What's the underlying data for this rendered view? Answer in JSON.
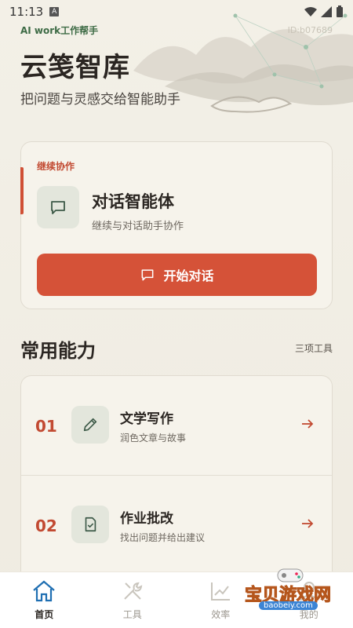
{
  "status_bar": {
    "time": "11:13",
    "notif_glyph": "A"
  },
  "header": {
    "app_subtitle": "AI work工作帮手",
    "app_id": "ID:b07689",
    "title": "云笺智库",
    "subtitle": "把问题与灵感交给智能助手"
  },
  "continue_card": {
    "label": "继续协作",
    "agent_title": "对话智能体",
    "agent_desc": "继续与对话助手协作",
    "button_label": "开始对话",
    "icon": "chat-bubble-icon"
  },
  "section": {
    "title": "常用能力",
    "count": "三项工具"
  },
  "tools": [
    {
      "num": "01",
      "title": "文学写作",
      "desc": "润色文章与故事",
      "icon": "pencil-icon"
    },
    {
      "num": "02",
      "title": "作业批改",
      "desc": "找出问题并给出建议",
      "icon": "checklist-icon"
    }
  ],
  "bottom_nav": {
    "items": [
      {
        "label": "首页",
        "icon": "home-icon",
        "active": true
      },
      {
        "label": "工具",
        "icon": "tools-icon",
        "active": false
      },
      {
        "label": "效率",
        "icon": "chart-icon",
        "active": false
      },
      {
        "label": "我的",
        "icon": "user-icon",
        "active": false
      }
    ]
  },
  "watermark": {
    "text": "宝贝游戏网",
    "url": "baobeiy.com"
  },
  "colors": {
    "accent": "#d55238",
    "nav_active": "#1f6fb2",
    "icon_bg": "#e3e6dc"
  }
}
